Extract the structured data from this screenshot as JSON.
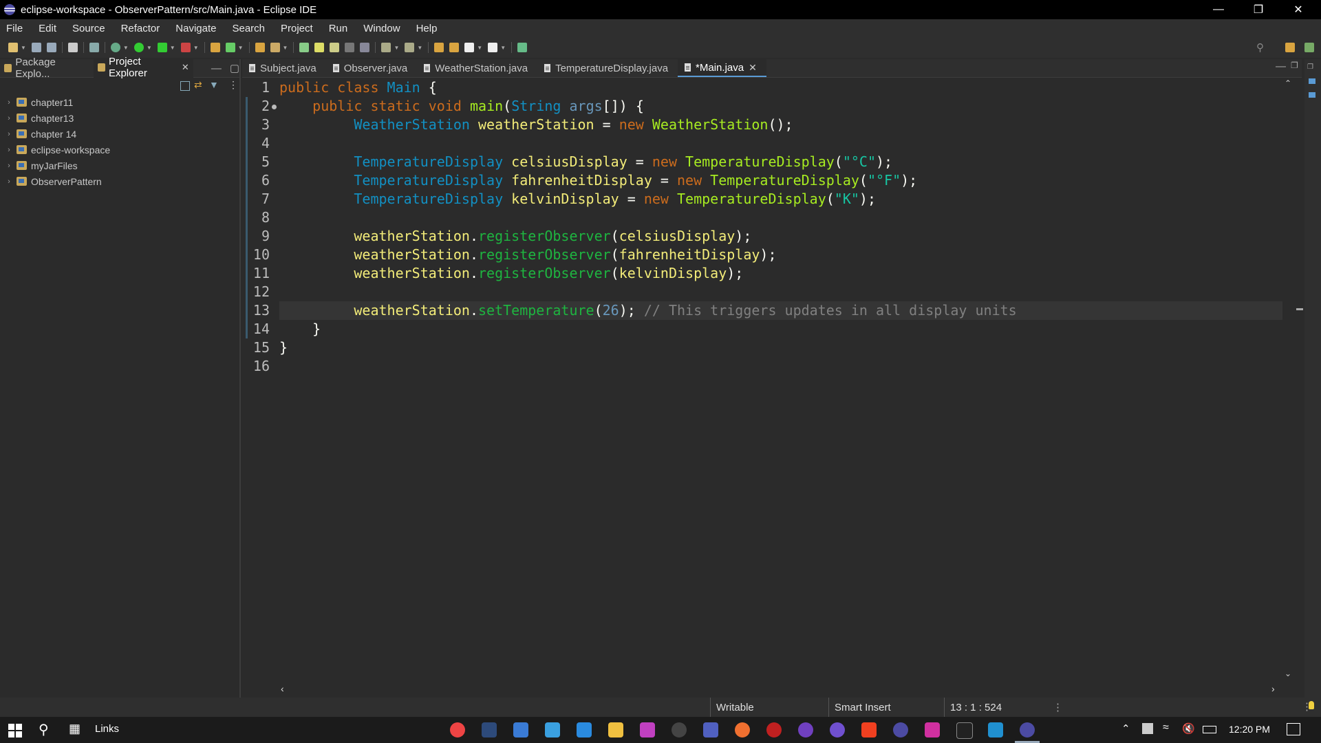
{
  "window": {
    "title": "eclipse-workspace - ObserverPattern/src/Main.java - Eclipse IDE"
  },
  "menu": [
    "File",
    "Edit",
    "Source",
    "Refactor",
    "Navigate",
    "Search",
    "Project",
    "Run",
    "Window",
    "Help"
  ],
  "left_panel": {
    "tabs": [
      {
        "label": "Package Explo...",
        "active": false
      },
      {
        "label": "Project Explorer",
        "active": true
      }
    ],
    "tree": [
      "chapter11",
      "chapter13",
      "chapter 14",
      "eclipse-workspace",
      "myJarFiles",
      "ObserverPattern"
    ]
  },
  "editor_tabs": [
    {
      "label": "Subject.java",
      "active": false
    },
    {
      "label": "Observer.java",
      "active": false
    },
    {
      "label": "WeatherStation.java",
      "active": false
    },
    {
      "label": "TemperatureDisplay.java",
      "active": false
    },
    {
      "label": "*Main.java",
      "active": true
    }
  ],
  "code": {
    "line_numbers": [
      "1",
      "2",
      "3",
      "4",
      "5",
      "6",
      "7",
      "8",
      "9",
      "10",
      "11",
      "12",
      "13",
      "14",
      "15",
      "16"
    ],
    "current_line": 13,
    "lines": [
      [
        [
          "kw",
          "public "
        ],
        [
          "kw",
          "class "
        ],
        [
          "ty",
          "Main "
        ],
        [
          "pl",
          "{"
        ]
      ],
      [
        [
          "pl",
          "    "
        ],
        [
          "kw",
          "public "
        ],
        [
          "kw",
          "static "
        ],
        [
          "kw",
          "void "
        ],
        [
          "fn",
          "main"
        ],
        [
          "pl",
          "("
        ],
        [
          "ty",
          "String "
        ],
        [
          "nm",
          "args"
        ],
        [
          "pl",
          "[]) {"
        ]
      ],
      [
        [
          "pl",
          "         "
        ],
        [
          "ty",
          "WeatherStation "
        ],
        [
          "vr",
          "weatherStation "
        ],
        [
          "pl",
          "= "
        ],
        [
          "kw",
          "new "
        ],
        [
          "fn",
          "WeatherStation"
        ],
        [
          "pl",
          "();"
        ]
      ],
      [],
      [
        [
          "pl",
          "         "
        ],
        [
          "ty",
          "TemperatureDisplay "
        ],
        [
          "vr",
          "celsiusDisplay "
        ],
        [
          "pl",
          "= "
        ],
        [
          "kw",
          "new "
        ],
        [
          "fn",
          "TemperatureDisplay"
        ],
        [
          "pl",
          "("
        ],
        [
          "st",
          "\"°C\""
        ],
        [
          "pl",
          ");"
        ]
      ],
      [
        [
          "pl",
          "         "
        ],
        [
          "ty",
          "TemperatureDisplay "
        ],
        [
          "vr",
          "fahrenheitDisplay "
        ],
        [
          "pl",
          "= "
        ],
        [
          "kw",
          "new "
        ],
        [
          "fn",
          "TemperatureDisplay"
        ],
        [
          "pl",
          "("
        ],
        [
          "st",
          "\"°F\""
        ],
        [
          "pl",
          ");"
        ]
      ],
      [
        [
          "pl",
          "         "
        ],
        [
          "ty",
          "TemperatureDisplay "
        ],
        [
          "vr",
          "kelvinDisplay "
        ],
        [
          "pl",
          "= "
        ],
        [
          "kw",
          "new "
        ],
        [
          "fn",
          "TemperatureDisplay"
        ],
        [
          "pl",
          "("
        ],
        [
          "st",
          "\"K\""
        ],
        [
          "pl",
          ");"
        ]
      ],
      [],
      [
        [
          "pl",
          "         "
        ],
        [
          "vr",
          "weatherStation"
        ],
        [
          "pl",
          "."
        ],
        [
          "mt",
          "registerObserver"
        ],
        [
          "pl",
          "("
        ],
        [
          "vr",
          "celsiusDisplay"
        ],
        [
          "pl",
          ");"
        ]
      ],
      [
        [
          "pl",
          "         "
        ],
        [
          "vr",
          "weatherStation"
        ],
        [
          "pl",
          "."
        ],
        [
          "mt",
          "registerObserver"
        ],
        [
          "pl",
          "("
        ],
        [
          "vr",
          "fahrenheitDisplay"
        ],
        [
          "pl",
          ");"
        ]
      ],
      [
        [
          "pl",
          "         "
        ],
        [
          "vr",
          "weatherStation"
        ],
        [
          "pl",
          "."
        ],
        [
          "mt",
          "registerObserver"
        ],
        [
          "pl",
          "("
        ],
        [
          "vr",
          "kelvinDisplay"
        ],
        [
          "pl",
          ");"
        ]
      ],
      [],
      [
        [
          "pl",
          "         "
        ],
        [
          "vr",
          "weatherStation"
        ],
        [
          "pl",
          "."
        ],
        [
          "mt",
          "setTemperature"
        ],
        [
          "pl",
          "("
        ],
        [
          "nm",
          "26"
        ],
        [
          "pl",
          "); "
        ],
        [
          "cm",
          "// This triggers updates in all display units"
        ]
      ],
      [
        [
          "pl",
          "    }"
        ]
      ],
      [
        [
          "pl",
          "}"
        ]
      ],
      []
    ]
  },
  "status": {
    "writable": "Writable",
    "insert_mode": "Smart Insert",
    "position": "13 : 1 : 524"
  },
  "taskbar": {
    "links_label": "Links",
    "time": "12:20 PM"
  },
  "colors": {
    "accent": "#5a9bd5",
    "background": "#2b2b2b"
  }
}
